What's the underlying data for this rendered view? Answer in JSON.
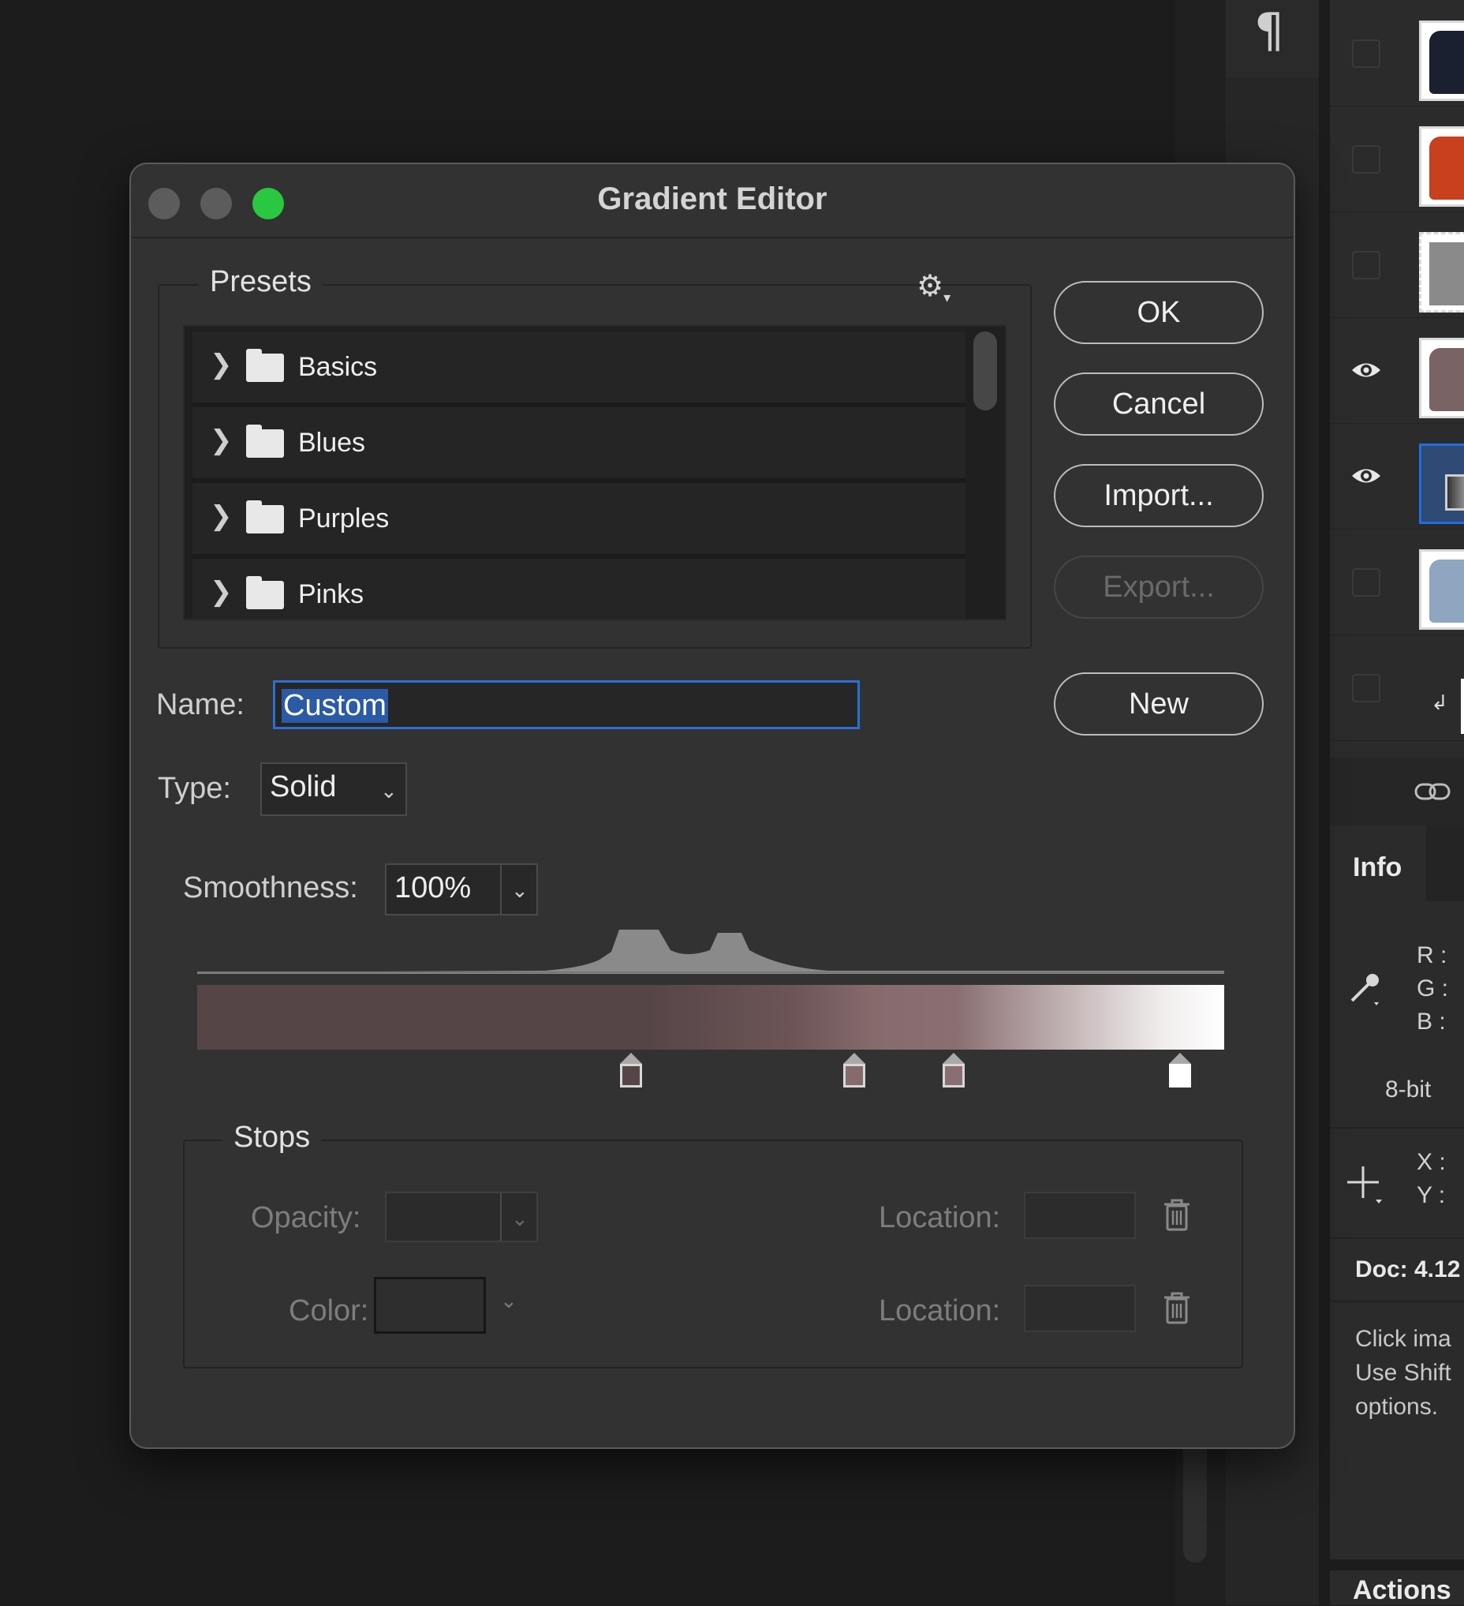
{
  "dialog": {
    "title": "Gradient Editor",
    "presets": {
      "legend": "Presets",
      "items": [
        {
          "label": "Basics"
        },
        {
          "label": "Blues"
        },
        {
          "label": "Purples"
        },
        {
          "label": "Pinks"
        }
      ]
    },
    "buttons": {
      "ok": "OK",
      "cancel": "Cancel",
      "import": "Import...",
      "export": "Export...",
      "new": "New"
    },
    "name_label": "Name:",
    "name_value": "Custom",
    "type_label": "Type:",
    "type_value": "Solid",
    "smoothness_label": "Smoothness:",
    "smoothness_value": "100%",
    "gradient_colors": [
      "#564547",
      "#6d5557",
      "#866b6d",
      "#8a6f72",
      "#ffffff"
    ],
    "color_stops": [
      {
        "location_pct": 42,
        "color": "#564547"
      },
      {
        "location_pct": 64,
        "color": "#866b6d"
      },
      {
        "location_pct": 74,
        "color": "#8a6f72"
      },
      {
        "location_pct": 96,
        "color": "#ffffff"
      }
    ],
    "stops": {
      "legend": "Stops",
      "opacity_label": "Opacity:",
      "color_label": "Color:",
      "location_label_1": "Location:",
      "location_label_2": "Location:"
    }
  },
  "right_panel": {
    "paragraph_glyph": "¶",
    "layers": [
      {
        "visible": false,
        "thumb_color": "#1b2030",
        "icon": "tshirt-icon"
      },
      {
        "visible": false,
        "thumb_color": "#c8401e",
        "icon": "tshirt-icon"
      },
      {
        "visible": false,
        "thumb_color": "#8a8a8a",
        "icon": "transparent-layer-icon"
      },
      {
        "visible": true,
        "thumb_color": "#7a6365",
        "icon": "tshirt-icon"
      },
      {
        "visible": true,
        "thumb_color": "#3a4a62",
        "icon": "gradient-fill-icon",
        "selected": true
      },
      {
        "visible": false,
        "thumb_color": "#8ea6c0",
        "icon": "tshirt-icon"
      },
      {
        "visible": false,
        "thumb_color": "#ffffff",
        "icon": "clipping-mask-icon"
      }
    ],
    "info": {
      "tab": "Info",
      "r": "R :",
      "g": "G :",
      "b": "B :",
      "bit": "8-bit",
      "x": "X :",
      "y": "Y :",
      "doc": "Doc: 4.12",
      "hint_line1": "Click ima",
      "hint_line2": "Use Shift",
      "hint_line3": "options."
    },
    "actions_tab": "Actions"
  }
}
